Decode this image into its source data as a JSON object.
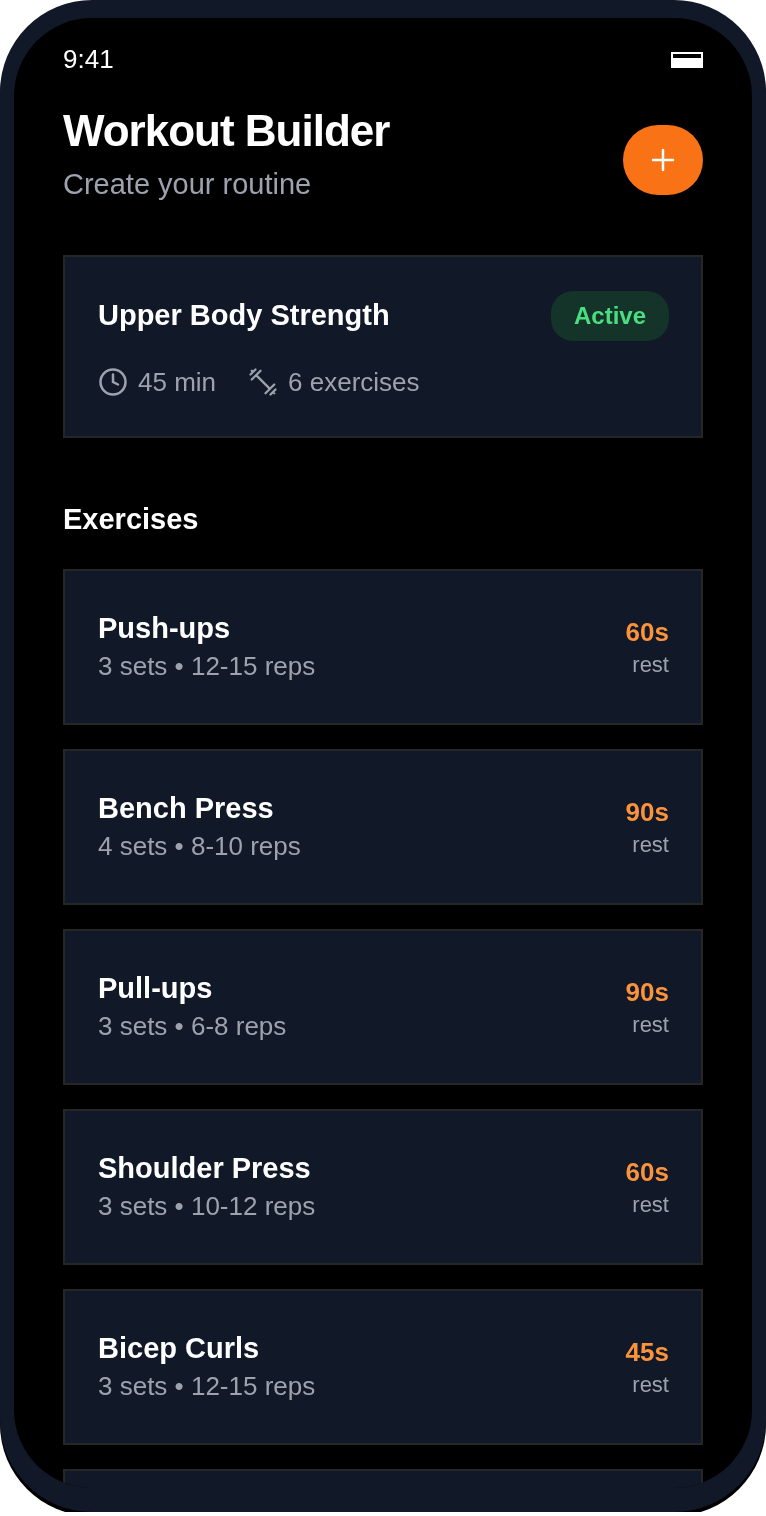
{
  "status_bar": {
    "time": "9:41"
  },
  "header": {
    "title": "Workout Builder",
    "subtitle": "Create your routine"
  },
  "workout": {
    "name": "Upper Body Strength",
    "status": "Active",
    "duration": "45 min",
    "exercise_count": "6 exercises"
  },
  "section_title": "Exercises",
  "exercises": [
    {
      "name": "Push-ups",
      "details": "3 sets • 12-15 reps",
      "rest": "60s",
      "rest_label": "rest"
    },
    {
      "name": "Bench Press",
      "details": "4 sets • 8-10 reps",
      "rest": "90s",
      "rest_label": "rest"
    },
    {
      "name": "Pull-ups",
      "details": "3 sets • 6-8 reps",
      "rest": "90s",
      "rest_label": "rest"
    },
    {
      "name": "Shoulder Press",
      "details": "3 sets • 10-12 reps",
      "rest": "60s",
      "rest_label": "rest"
    },
    {
      "name": "Bicep Curls",
      "details": "3 sets • 12-15 reps",
      "rest": "45s",
      "rest_label": "rest"
    }
  ]
}
